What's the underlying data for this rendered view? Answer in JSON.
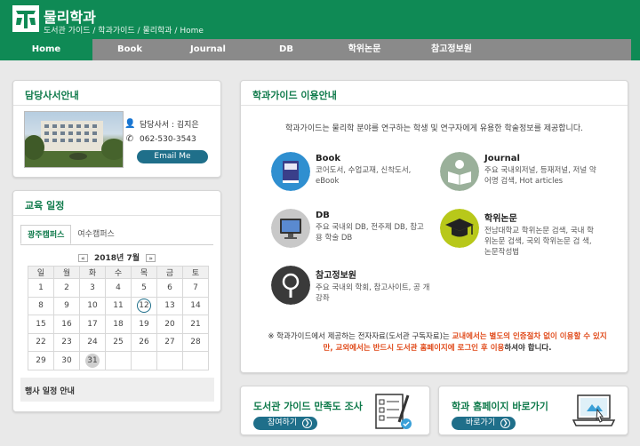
{
  "header": {
    "title": "물리학과",
    "breadcrumb": "도서관 가이드 / 학과가이드 / 물리학과 / Home"
  },
  "nav": {
    "items": [
      "Home",
      "Book",
      "Journal",
      "DB",
      "학위논문",
      "참고정보원"
    ]
  },
  "librarian": {
    "title": "담당사서안내",
    "name": "담당사서 : 김지은",
    "phone": "062-530-3543",
    "email_button": "Email Me"
  },
  "calendar": {
    "title": "교육 일정",
    "tabs": [
      "광주캠퍼스",
      "여수캠퍼스"
    ],
    "prev": "«",
    "next": "»",
    "month": "2018년 7월",
    "weekdays": [
      "일",
      "월",
      "화",
      "수",
      "목",
      "금",
      "토"
    ],
    "rows": [
      [
        "1",
        "2",
        "3",
        "4",
        "5",
        "6",
        "7"
      ],
      [
        "8",
        "9",
        "10",
        "11",
        "12",
        "13",
        "14"
      ],
      [
        "15",
        "16",
        "17",
        "18",
        "19",
        "20",
        "21"
      ],
      [
        "22",
        "23",
        "24",
        "25",
        "26",
        "27",
        "28"
      ],
      [
        "29",
        "30",
        "31",
        "",
        "",
        "",
        ""
      ]
    ],
    "today": "12",
    "selected": "31",
    "events_label": "행사 일정 안내"
  },
  "guide": {
    "title": "학과가이드 이용안내",
    "description": "학과가이드는 물리학 분야를 연구하는 학생 및 연구자에게 유용한 학술정보를 제공합니다.",
    "items": [
      {
        "name": "Book",
        "desc": "코어도서, 수업교재, 신착도서, eBook",
        "icon": "book-icon"
      },
      {
        "name": "Journal",
        "desc": "주요 국내외저널, 등재저널, 저널 약어명 검색, Hot articles",
        "icon": "journal-icon"
      },
      {
        "name": "DB",
        "desc": "주요 국내외 DB, 전주제 DB, 참고 용 학술 DB",
        "icon": "monitor-icon"
      },
      {
        "name": "학위논문",
        "desc": "전남대학교 학위논문 검색, 국내 학위논문 검색, 국외 학위논문 검 색, 논문작성법",
        "icon": "graduation-cap-icon"
      },
      {
        "name": "참고정보원",
        "desc": "주요 국내외 학회, 참고사이트, 공 개강좌",
        "icon": "magnifier-icon"
      }
    ],
    "note_prefix": "※ 학과가이드에서 제공하는 전자자료(도서관 구독자료)는 ",
    "note_hl1": "교내에서는 별도의 인증절차 없이 이용할 수 있지만, 교외에서는 반드시 도서관 홈페이지에 로그인 후 이용",
    "note_suffix": "하셔야 합니다."
  },
  "survey": {
    "title": "도서관 가이드 만족도 조사",
    "button": "참여하기",
    "icon": "checklist-icon"
  },
  "homepage": {
    "title": "학과 홈페이지 바로가기",
    "button": "바로가기",
    "icon": "laptop-icon"
  },
  "colors": {
    "brand": "#0f8a55",
    "nav_bg": "#8a8a8a",
    "button": "#1f6f8a",
    "highlight": "#e04a1a"
  }
}
